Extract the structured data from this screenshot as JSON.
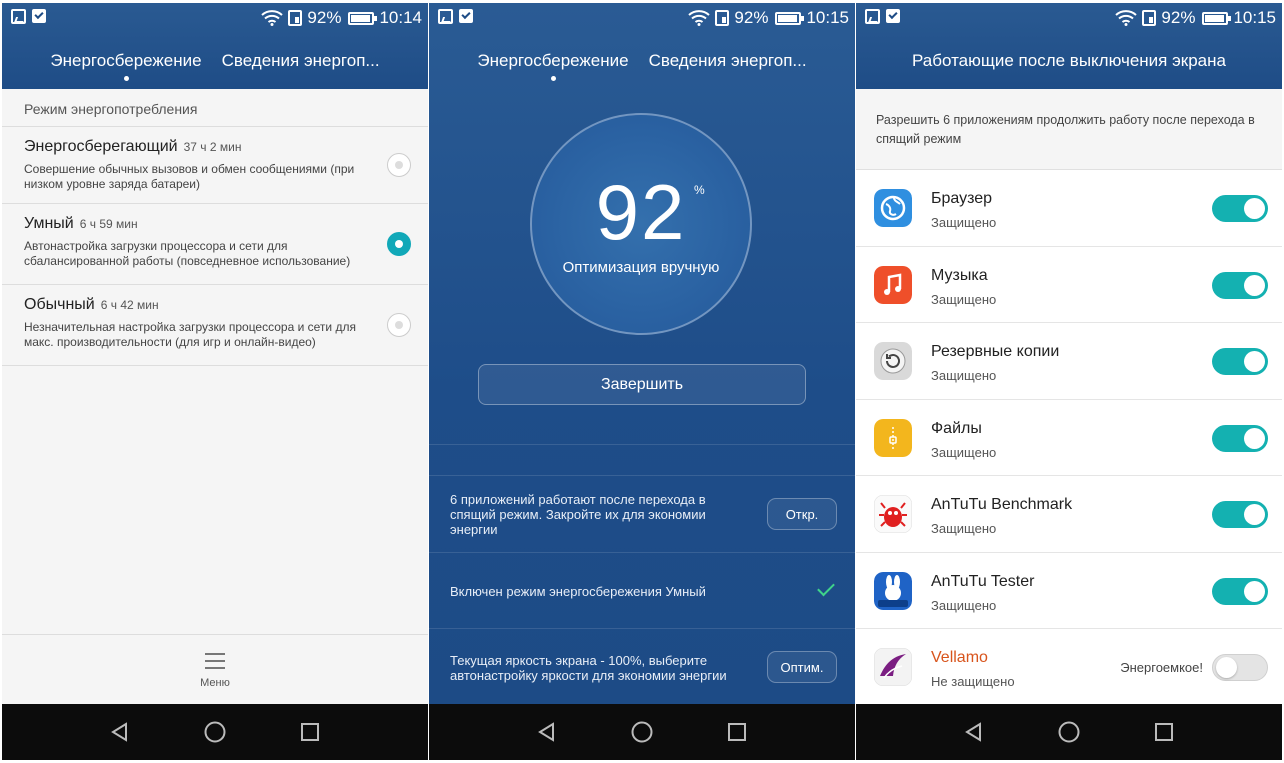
{
  "status_bars": [
    {
      "battery": "92%",
      "time": "10:14"
    },
    {
      "battery": "92%",
      "time": "10:15"
    },
    {
      "battery": "92%",
      "time": "10:15"
    }
  ],
  "panel1": {
    "tabs": [
      "Энергосбережение",
      "Сведения энергоп..."
    ],
    "section": "Режим энергопотребления",
    "modes": [
      {
        "name": "Энергосберегающий",
        "time": "37 ч 2 мин",
        "desc": "Совершение обычных вызовов и обмен сообщениями (при низком уровне заряда батареи)",
        "selected": false
      },
      {
        "name": "Умный",
        "time": "6 ч 59 мин",
        "desc": "Автонастройка загрузки процессора и сети для сбалансированной работы (повседневное использование)",
        "selected": true
      },
      {
        "name": "Обычный",
        "time": "6 ч 42 мин",
        "desc": "Незначительная настройка загрузки процессора и сети для макс. производительности (для игр и онлайн-видео)",
        "selected": false
      }
    ],
    "menu_label": "Меню"
  },
  "panel2": {
    "tabs": [
      "Энергосбережение",
      "Сведения энергоп..."
    ],
    "percent_value": "92",
    "percent_sign": "%",
    "status": "Оптимизация вручную",
    "finish_button": "Завершить",
    "rows": [
      {
        "text": "6 приложений работают после перехода в спящий режим. Закройте их для экономии энергии",
        "button": "Откр."
      },
      {
        "text": "Включен режим энергосбережения Умный",
        "checked": true
      },
      {
        "text": "Текущая яркость экрана - 100%, выберите автонастройку яркости для экономии энергии",
        "button": "Оптим."
      }
    ]
  },
  "panel3": {
    "title": "Работающие после выключения экрана",
    "intro": "Разрешить 6 приложениям продолжить работу после перехода в спящий режим",
    "apps": [
      {
        "name": "Браузер",
        "status": "Защищено",
        "icon": "browser-icon",
        "enabled": true
      },
      {
        "name": "Музыка",
        "status": "Защищено",
        "icon": "music-icon",
        "enabled": true
      },
      {
        "name": "Резервные копии",
        "status": "Защищено",
        "icon": "backup-icon",
        "enabled": true
      },
      {
        "name": "Файлы",
        "status": "Защищено",
        "icon": "files-icon",
        "enabled": true
      },
      {
        "name": "AnTuTu Benchmark",
        "status": "Защищено",
        "icon": "antutu-benchmark-icon",
        "enabled": true
      },
      {
        "name": "AnTuTu Tester",
        "status": "Защищено",
        "icon": "antutu-tester-icon",
        "enabled": true
      },
      {
        "name": "Vellamo",
        "status": "Не защищено",
        "icon": "vellamo-icon",
        "enabled": false,
        "warning": "Энергоемкое!",
        "name_color": "#d8541c"
      }
    ]
  },
  "colors": {
    "header": "#1e4c86",
    "accent": "#14b1b1",
    "check": "#3fd48a",
    "warning_name": "#d8541c"
  }
}
